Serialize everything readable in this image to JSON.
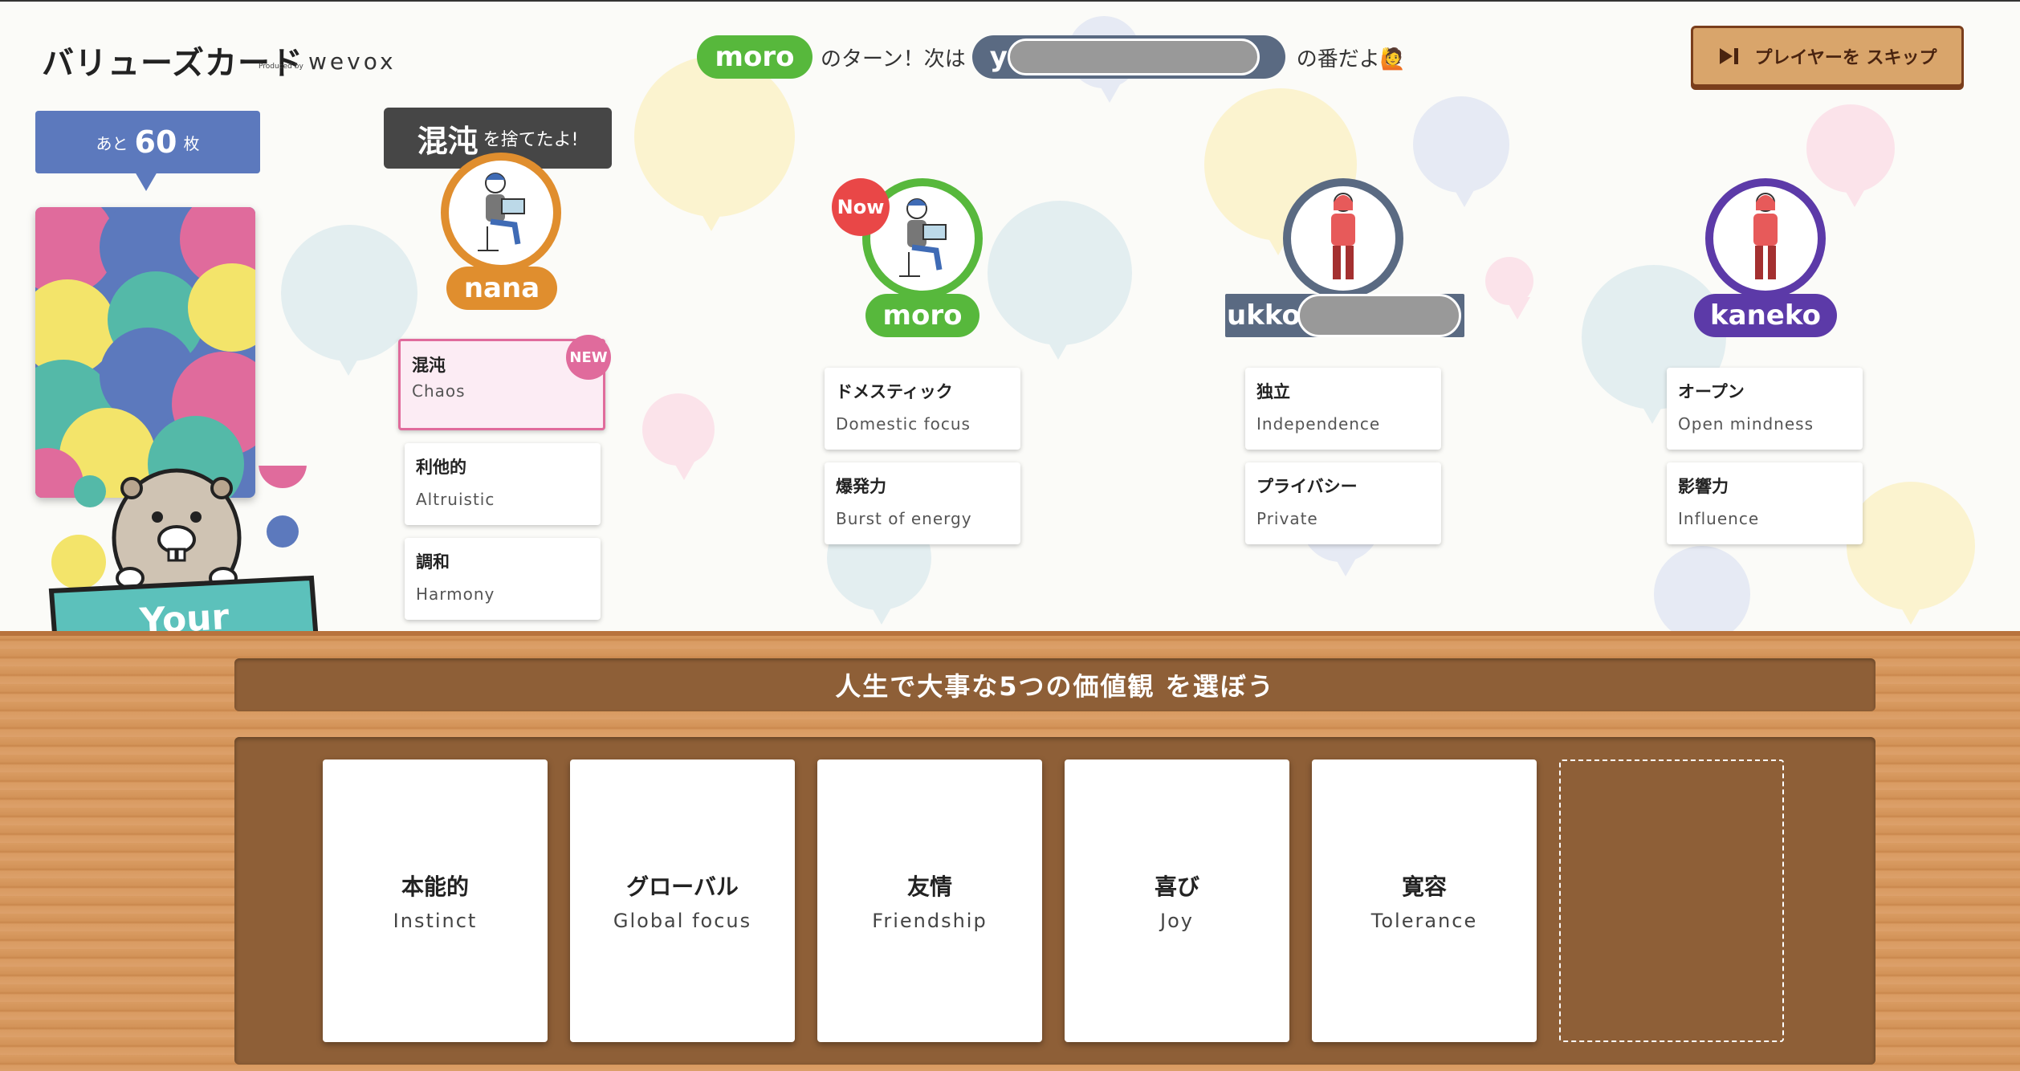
{
  "header": {
    "logo": "バリューズカード",
    "produced_by": "Produced by",
    "brand": "wevox",
    "current_player": "moro",
    "turn_text": "のターン！次は",
    "next_player_initial": "y",
    "next_text": "の番だよ🙋",
    "skip_label": "プレイヤーを スキップ"
  },
  "deck": {
    "prefix": "あと",
    "remaining": "60",
    "suffix": "枚",
    "mascot_label": "Your Values"
  },
  "toast": {
    "word": "混沌",
    "message": "を捨てたよ!"
  },
  "players": [
    {
      "name": "nana",
      "color": "#e08e2e",
      "cards": [
        {
          "jp": "混沌",
          "en": "Chaos",
          "is_new": true,
          "badge": "NEW"
        },
        {
          "jp": "利他的",
          "en": "Altruistic"
        },
        {
          "jp": "調和",
          "en": "Harmony"
        }
      ]
    },
    {
      "name": "moro",
      "color": "#57b83c",
      "now_badge": "Now",
      "cards": [
        {
          "jp": "ドメスティック",
          "en": "Domestic focus"
        },
        {
          "jp": "爆発力",
          "en": "Burst of energy"
        }
      ]
    },
    {
      "name": "ukko(",
      "color": "#5a6a82",
      "cards": [
        {
          "jp": "独立",
          "en": "Independence"
        },
        {
          "jp": "プライバシー",
          "en": "Private"
        }
      ]
    },
    {
      "name": "kaneko",
      "color": "#5c3aa8",
      "cards": [
        {
          "jp": "オープン",
          "en": "Open mindness"
        },
        {
          "jp": "影響力",
          "en": "Influence"
        }
      ]
    }
  ],
  "table": {
    "prompt": "人生で大事な5つの価値観 を選ぼう",
    "selected": [
      {
        "jp": "本能的",
        "en": "Instinct"
      },
      {
        "jp": "グローバル",
        "en": "Global focus"
      },
      {
        "jp": "友情",
        "en": "Friendship"
      },
      {
        "jp": "喜び",
        "en": "Joy"
      },
      {
        "jp": "寛容",
        "en": "Tolerance"
      }
    ]
  }
}
